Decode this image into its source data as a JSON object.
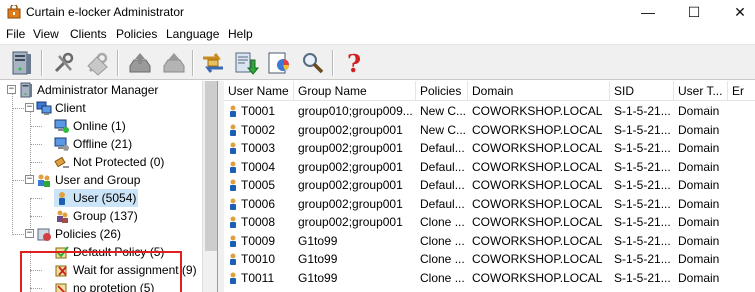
{
  "window": {
    "title": "Curtain e-locker Administrator",
    "minimize": "—",
    "maximize": "☐",
    "close": "✕"
  },
  "menu": [
    "File",
    "View",
    "Clients",
    "Policies",
    "Language",
    "Help"
  ],
  "toolbar": {
    "buttons": [
      "server-icon",
      "tools-icon",
      "tools-gray-icon",
      "upload-tray-icon",
      "upload-tray-gray-icon",
      "exchange-icon",
      "download-doc-icon",
      "report-icon",
      "magnifier-icon",
      "help-question-icon"
    ],
    "help_glyph": "?"
  },
  "tree": {
    "root": "Administrator Manager",
    "client": "Client",
    "online": "Online (1)",
    "offline": "Offline (21)",
    "not_protected": "Not Protected (0)",
    "user_and_group": "User and Group",
    "user": "User (5054)",
    "group": "Group (137)",
    "policies": "Policies (26)",
    "default_policy": "Default Policy (5)",
    "wait_assignment": "Wait for assignment (9)",
    "no_protetion": "no protetion (5)",
    "expand_minus": "−"
  },
  "colors": {
    "highlight_border": "#e02020",
    "accent_blue": "#1a5fb4"
  },
  "grid": {
    "columns": [
      "User Name",
      "Group Name",
      "Policies",
      "Domain",
      "SID",
      "User T...",
      "Er"
    ],
    "rows": [
      [
        "T0001",
        "group010;group009...",
        "New C...",
        "COWORKSHOP.LOCAL",
        "S-1-5-21...",
        "Domain"
      ],
      [
        "T0002",
        "group002;group001",
        "New C...",
        "COWORKSHOP.LOCAL",
        "S-1-5-21...",
        "Domain"
      ],
      [
        "T0003",
        "group002;group001",
        "Defaul...",
        "COWORKSHOP.LOCAL",
        "S-1-5-21...",
        "Domain"
      ],
      [
        "T0004",
        "group002;group001",
        "Defaul...",
        "COWORKSHOP.LOCAL",
        "S-1-5-21...",
        "Domain"
      ],
      [
        "T0005",
        "group002;group001",
        "Defaul...",
        "COWORKSHOP.LOCAL",
        "S-1-5-21...",
        "Domain"
      ],
      [
        "T0006",
        "group002;group001",
        "Defaul...",
        "COWORKSHOP.LOCAL",
        "S-1-5-21...",
        "Domain"
      ],
      [
        "T0008",
        "group002;group001",
        "Clone ...",
        "COWORKSHOP.LOCAL",
        "S-1-5-21...",
        "Domain"
      ],
      [
        "T0009",
        "G1to99",
        "Clone ...",
        "COWORKSHOP.LOCAL",
        "S-1-5-21...",
        "Domain"
      ],
      [
        "T0010",
        "G1to99",
        "Clone ...",
        "COWORKSHOP.LOCAL",
        "S-1-5-21...",
        "Domain"
      ],
      [
        "T0011",
        "G1to99",
        "Clone ...",
        "COWORKSHOP.LOCAL",
        "S-1-5-21...",
        "Domain"
      ]
    ]
  }
}
